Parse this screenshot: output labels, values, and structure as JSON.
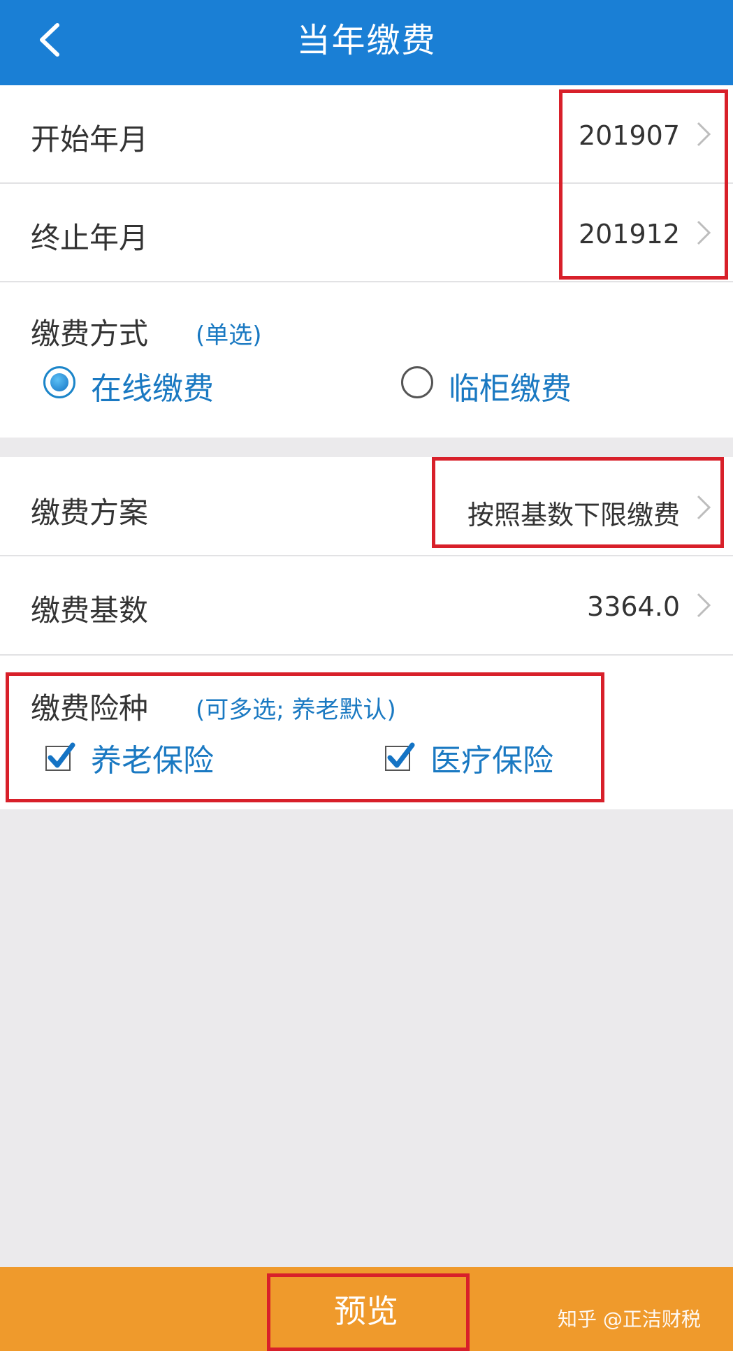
{
  "header": {
    "title": "当年缴费",
    "back_icon": "chevron-left-icon"
  },
  "start_month": {
    "label": "开始年月",
    "value": "201907"
  },
  "end_month": {
    "label": "终止年月",
    "value": "201912"
  },
  "payment_method": {
    "label": "缴费方式",
    "hint": "(单选)",
    "options": [
      {
        "label": "在线缴费",
        "selected": true
      },
      {
        "label": "临柜缴费",
        "selected": false
      }
    ]
  },
  "payment_plan": {
    "label": "缴费方案",
    "value": "按照基数下限缴费"
  },
  "payment_base": {
    "label": "缴费基数",
    "value": "3364.0"
  },
  "insurance_types": {
    "label": "缴费险种",
    "hint": "(可多选; 养老默认)",
    "options": [
      {
        "label": "养老保险",
        "checked": true
      },
      {
        "label": "医疗保险",
        "checked": true
      }
    ]
  },
  "footer": {
    "preview_label": "预览",
    "watermark": "知乎 @正洁财税"
  },
  "colors": {
    "header_bg": "#1a7fd5",
    "accent_blue": "#1a79c2",
    "footer_bg": "#ef9a2c",
    "highlight_red": "#d8202a",
    "page_bg": "#ebeaec"
  }
}
